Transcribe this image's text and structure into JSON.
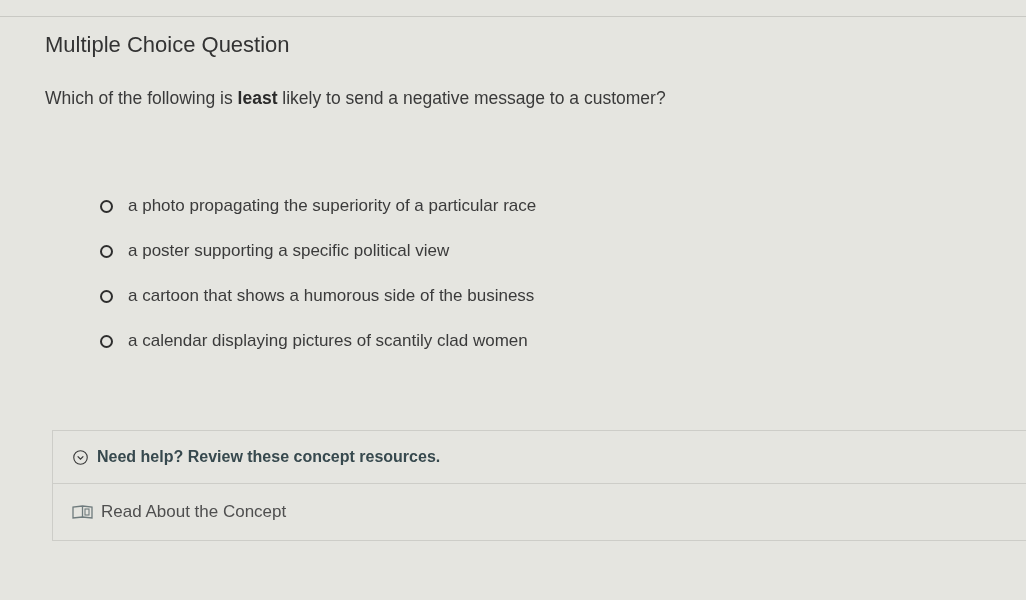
{
  "header": {
    "title": "Multiple Choice Question"
  },
  "question": {
    "text": "Which of the following is **least** likely to send a negative message to a customer?"
  },
  "options": [
    {
      "label": "a photo propagating the superiority of a particular race",
      "selected": false
    },
    {
      "label": "a poster supporting a specific political view",
      "selected": false
    },
    {
      "label": "a cartoon that shows a humorous side of the business",
      "selected": false
    },
    {
      "label": "a calendar displaying pictures of scantily clad women",
      "selected": false
    }
  ],
  "help": {
    "heading": "Need help? Review these concept resources.",
    "expanded": true,
    "resources": [
      {
        "label": "Read About the Concept"
      }
    ]
  }
}
